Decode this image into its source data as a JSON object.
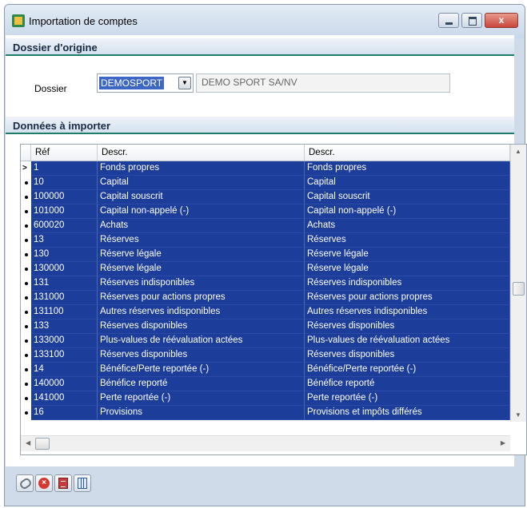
{
  "window": {
    "title": "Importation de comptes",
    "close_label": "x"
  },
  "origin_section": {
    "title": "Dossier d'origine",
    "dossier_label": "Dossier",
    "dossier_value": "DEMOSPORT",
    "dossier_description": "DEMO SPORT SA/NV"
  },
  "import_section": {
    "title": "Données à importer"
  },
  "grid": {
    "columns": [
      "Réf",
      "Descr.",
      "Descr."
    ],
    "current_row_marker": ">",
    "rows": [
      {
        "ref": "1",
        "descr": "Fonds propres",
        "descr2": "Fonds propres"
      },
      {
        "ref": "10",
        "descr": "Capital",
        "descr2": "Capital"
      },
      {
        "ref": "100000",
        "descr": "Capital souscrit",
        "descr2": "Capital souscrit"
      },
      {
        "ref": "101000",
        "descr": "Capital non-appelé (-)",
        "descr2": "Capital non-appelé (-)"
      },
      {
        "ref": "600020",
        "descr": "Achats",
        "descr2": "Achats"
      },
      {
        "ref": "13",
        "descr": "Réserves",
        "descr2": "Réserves"
      },
      {
        "ref": "130",
        "descr": "Réserve légale",
        "descr2": "Réserve légale"
      },
      {
        "ref": "130000",
        "descr": "Réserve légale",
        "descr2": "Réserve légale"
      },
      {
        "ref": "131",
        "descr": "Réserves indisponibles",
        "descr2": "Réserves indisponibles"
      },
      {
        "ref": "131000",
        "descr": "Réserves pour actions propres",
        "descr2": "Réserves pour actions propres"
      },
      {
        "ref": "131100",
        "descr": "Autres réserves indisponibles",
        "descr2": "Autres réserves indisponibles"
      },
      {
        "ref": "133",
        "descr": "Réserves disponibles",
        "descr2": "Réserves disponibles"
      },
      {
        "ref": "133000",
        "descr": "Plus-values de réévaluation actées",
        "descr2": "Plus-values de réévaluation actées"
      },
      {
        "ref": "133100",
        "descr": "Réserves disponibles",
        "descr2": "Réserves disponibles"
      },
      {
        "ref": "14",
        "descr": "Bénéfice/Perte reportée (-)",
        "descr2": "Bénéfice/Perte reportée (-)"
      },
      {
        "ref": "140000",
        "descr": "Bénéfice reporté",
        "descr2": "Bénéfice reporté"
      },
      {
        "ref": "141000",
        "descr": "Perte reportée (-)",
        "descr2": "Perte reportée (-)"
      },
      {
        "ref": "16",
        "descr": "Provisions",
        "descr2": "Provisions et impôts différés"
      }
    ]
  },
  "toolbar": {
    "icons": [
      "link-icon",
      "cancel-icon",
      "sheet-icon",
      "grid-icon"
    ]
  }
}
